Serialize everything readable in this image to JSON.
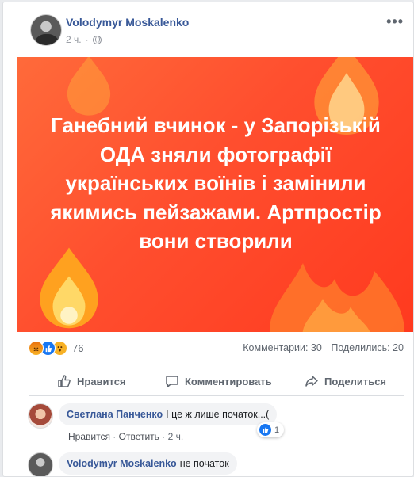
{
  "post": {
    "author": "Volodymyr Moskalenko",
    "time": "2 ч.",
    "privacy_icon": "globe-icon",
    "more_label": "•••",
    "text": "Ганебний вчинок - у Запорізькій ОДА зняли фотографії українських воїнів і замінили якимись пейзажами. Артпростір вони створили",
    "background_colors": [
      "#ff6a3a",
      "#ff3a1f"
    ]
  },
  "stats": {
    "reaction_icons": [
      "angry-icon",
      "like-icon",
      "wow-icon"
    ],
    "reaction_count": "76",
    "comments": "Комментарии: 30",
    "shares": "Поделились: 20"
  },
  "actions": {
    "like": "Нравится",
    "comment": "Комментировать",
    "share": "Поделиться"
  },
  "comments": [
    {
      "name": "Светлана Панченко",
      "text": "І це ж лише початок...(",
      "like_label": "Нравится",
      "reply_label": "Ответить",
      "time": "2 ч.",
      "reaction_count": "1"
    },
    {
      "name": "Volodymyr Moskalenko",
      "text": "не початок"
    }
  ],
  "colors": {
    "link": "#385898",
    "like_blue": "#1877f2"
  }
}
